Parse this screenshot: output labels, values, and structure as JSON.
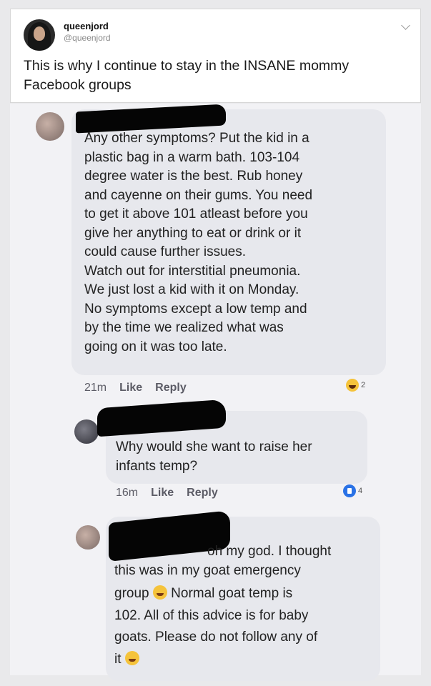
{
  "tweet": {
    "display_name": "queenjord",
    "handle": "@queenjord",
    "text": "This is why I continue to stay in the INSANE mommy Facebook groups"
  },
  "comments": [
    {
      "text": "Any other symptoms? Put the kid in a\nplastic bag in a warm bath. 103-104\ndegree water is the best. Rub honey\nand cayenne on their gums. You need\nto get it above 101 atleast before you\ngive her anything to eat or drink or it\ncould cause further issues.\nWatch out for interstitial pneumonia.\nWe just lost a kid with it on Monday.\nNo symptoms except a low temp and\nby the time we realized what was\ngoing on it was too late.",
      "time": "21m",
      "like_label": "Like",
      "reply_label": "Reply",
      "reaction_icon": "laugh-emoji-icon",
      "reaction_count": "2"
    },
    {
      "text": "Why would she want to raise her\ninfants temp?",
      "time": "16m",
      "like_label": "Like",
      "reply_label": "Reply",
      "reaction_icon": "like-thumb-icon",
      "reaction_count": "4"
    },
    {
      "line1": "oh my god. I thought",
      "line2": "this was in my goat emergency",
      "line3a": "group",
      "line3b": "Normal goat temp is",
      "line4": "102. All of this advice is for baby",
      "line5": "goats. Please do not follow any of",
      "line6": "it"
    }
  ],
  "colors": {
    "page_bg": "#e9e9eb",
    "bubble_bg": "#e7e8ed",
    "like_blue": "#2a72e6",
    "laugh_yellow": "#f5c33b"
  }
}
